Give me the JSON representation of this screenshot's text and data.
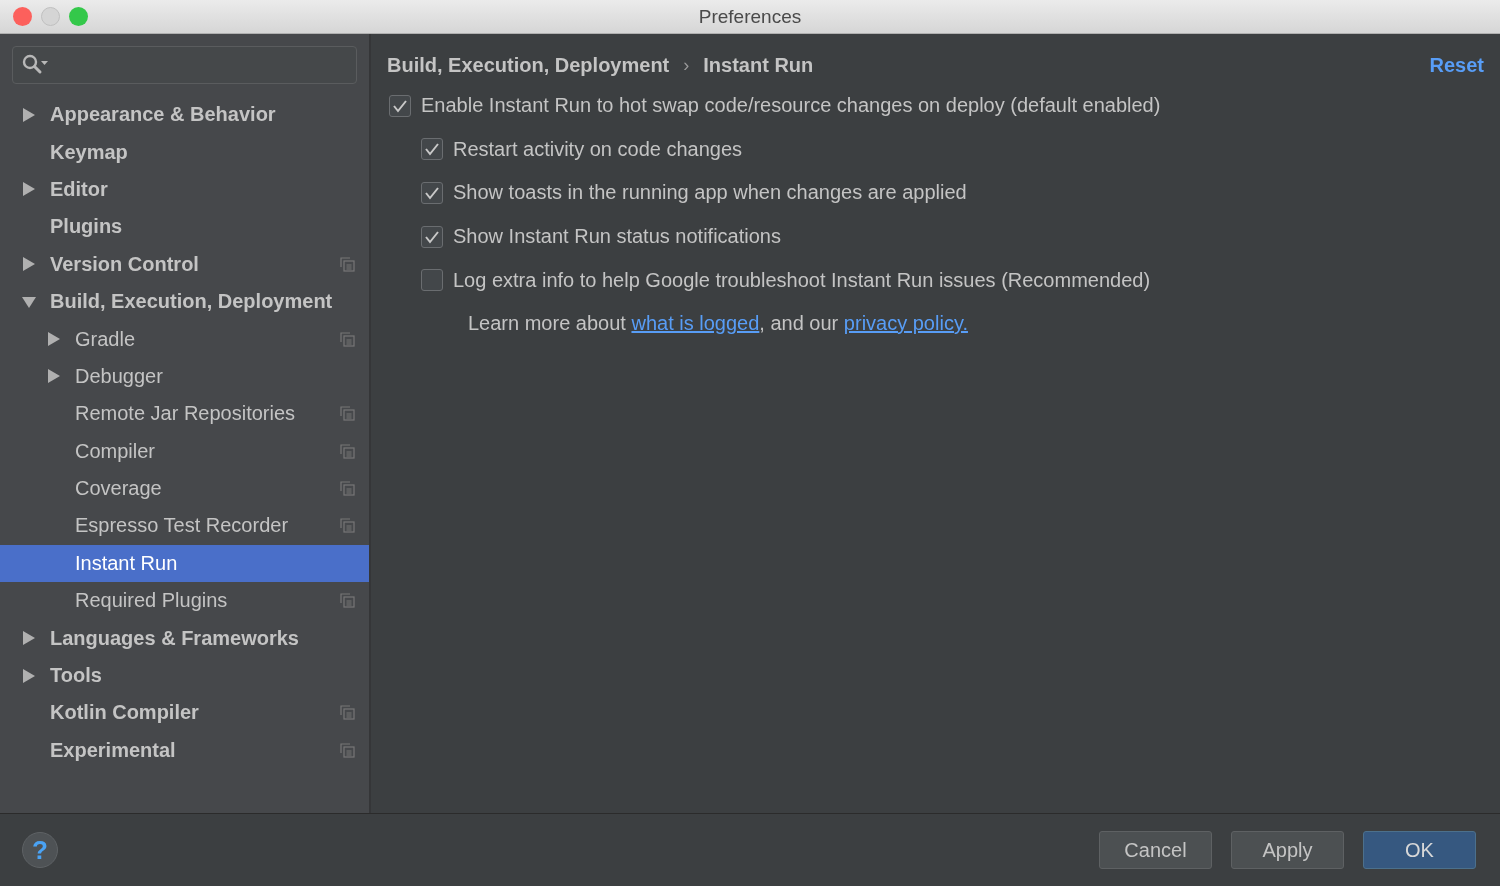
{
  "window": {
    "title": "Preferences"
  },
  "sidebar": {
    "items": [
      {
        "label": "Appearance & Behavior",
        "expanded": false,
        "selected": false
      },
      {
        "label": "Keymap",
        "selected": false
      },
      {
        "label": "Editor",
        "expanded": false,
        "selected": false
      },
      {
        "label": "Plugins",
        "selected": false
      },
      {
        "label": "Version Control",
        "expanded": false,
        "selected": false,
        "project_level": true
      },
      {
        "label": "Build, Execution, Deployment",
        "expanded": true,
        "selected": false,
        "children": [
          {
            "label": "Gradle",
            "expanded": false,
            "selected": false,
            "project_level": true
          },
          {
            "label": "Debugger",
            "expanded": false,
            "selected": false
          },
          {
            "label": "Remote Jar Repositories",
            "selected": false,
            "project_level": true
          },
          {
            "label": "Compiler",
            "selected": false,
            "project_level": true
          },
          {
            "label": "Coverage",
            "selected": false,
            "project_level": true
          },
          {
            "label": "Espresso Test Recorder",
            "selected": false,
            "project_level": true
          },
          {
            "label": "Instant Run",
            "selected": true
          },
          {
            "label": "Required Plugins",
            "selected": false,
            "project_level": true
          }
        ]
      },
      {
        "label": "Languages & Frameworks",
        "expanded": false,
        "selected": false
      },
      {
        "label": "Tools",
        "expanded": false,
        "selected": false
      },
      {
        "label": "Kotlin Compiler",
        "selected": false,
        "project_level": true
      },
      {
        "label": "Experimental",
        "selected": false,
        "project_level": true
      }
    ]
  },
  "breadcrumb": {
    "items": [
      "Build, Execution, Deployment",
      "Instant Run"
    ],
    "separator": "›"
  },
  "reset": "Reset",
  "options": [
    {
      "label": "Enable Instant Run to hot swap code/resource changes on deploy (default enabled)",
      "checked": true,
      "children": [
        {
          "label": "Restart activity on code changes",
          "checked": true
        },
        {
          "label": "Show toasts in the running app when changes are applied",
          "checked": true
        },
        {
          "label": "Show Instant Run status notifications",
          "checked": true
        },
        {
          "label": "Log extra info to help Google troubleshoot Instant Run issues (Recommended)",
          "checked": false
        }
      ]
    }
  ],
  "note": [
    {
      "kind": "text",
      "text": "Learn more about"
    },
    {
      "kind": "link",
      "text": "what is logged"
    },
    {
      "kind": "text",
      "text": ", and our"
    },
    {
      "kind": "link",
      "text": "privacy policy."
    }
  ],
  "help": "?",
  "buttons": [
    {
      "label": "Cancel",
      "default": false
    },
    {
      "label": "Apply",
      "default": false
    },
    {
      "label": "OK",
      "default": true
    }
  ]
}
